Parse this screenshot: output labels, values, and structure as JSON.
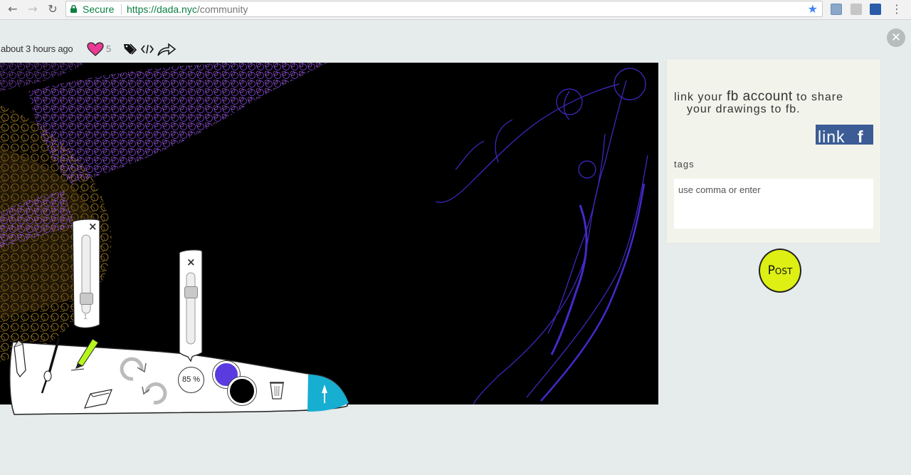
{
  "browser": {
    "secure_label": "Secure",
    "url_base": "https://dada.nyc",
    "url_path": "/community",
    "back_icon": "←",
    "forward_icon": "→",
    "reload_icon": "↻",
    "star_icon": "★",
    "menu_icon": "⋮"
  },
  "post_meta": {
    "time_ago": "about 3 hours ago",
    "likes": "5",
    "heart_color": "#e8308c"
  },
  "close_label": "✕",
  "share_panel": {
    "fb_text_1": "link your ",
    "fb_text_big": "fb account",
    "fb_text_2": " to share",
    "fb_text_3": "your drawings to fb.",
    "fb_button": "link",
    "fb_button_icon": "f",
    "tags_label": "tags",
    "tags_placeholder": "use comma or enter",
    "post_button": "Post"
  },
  "toolbar": {
    "opacity_value": "85 %",
    "size_slider_value": "1",
    "slider_close": "×",
    "accent_color": "#16aed1",
    "active_color": "#5a3be0",
    "secondary_color": "#000000",
    "brush_level": 0.1,
    "opacity_level": 0.85
  },
  "colors": {
    "fb_blue": "#3b5c94",
    "post_yellow": "#deef13",
    "drawing_purple": "#4a2bd6"
  }
}
